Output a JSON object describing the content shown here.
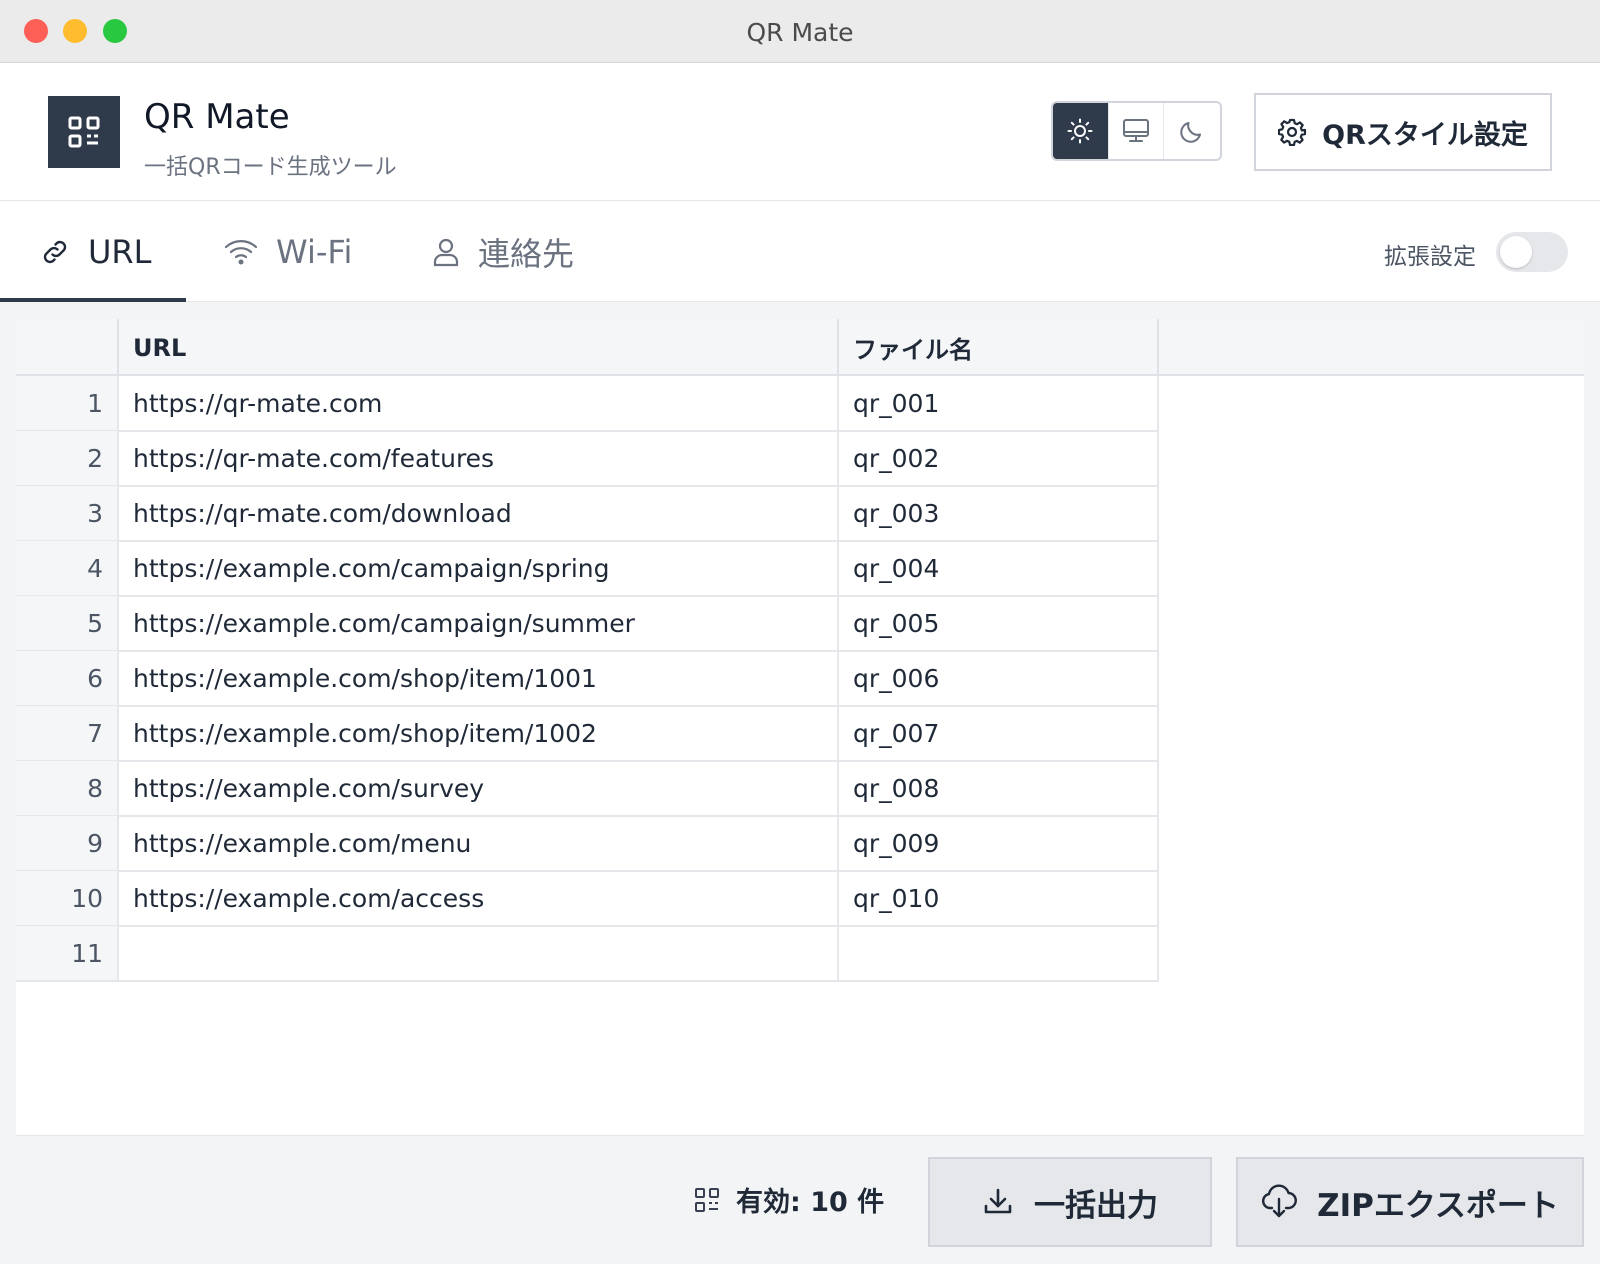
{
  "window": {
    "title": "QR Mate"
  },
  "header": {
    "app_name": "QR Mate",
    "subtitle": "一括QRコード生成ツール",
    "theme_options": [
      "sun-icon",
      "monitor-icon",
      "moon-icon"
    ],
    "active_theme": "light",
    "style_button_label": "QRスタイル設定"
  },
  "tabs": {
    "items": [
      {
        "label": "URL",
        "icon": "link-icon",
        "active": true
      },
      {
        "label": "Wi-Fi",
        "icon": "wifi-icon",
        "active": false
      },
      {
        "label": "連絡先",
        "icon": "user-icon",
        "active": false
      }
    ],
    "extended_settings_label": "拡張設定",
    "extended_settings_on": false
  },
  "table": {
    "columns": [
      "",
      "URL",
      "ファイル名"
    ],
    "rows": [
      {
        "num": "1",
        "url": "https://qr-mate.com",
        "file": "qr_001"
      },
      {
        "num": "2",
        "url": "https://qr-mate.com/features",
        "file": "qr_002"
      },
      {
        "num": "3",
        "url": "https://qr-mate.com/download",
        "file": "qr_003"
      },
      {
        "num": "4",
        "url": "https://example.com/campaign/spring",
        "file": "qr_004"
      },
      {
        "num": "5",
        "url": "https://example.com/campaign/summer",
        "file": "qr_005"
      },
      {
        "num": "6",
        "url": "https://example.com/shop/item/1001",
        "file": "qr_006"
      },
      {
        "num": "7",
        "url": "https://example.com/shop/item/1002",
        "file": "qr_007"
      },
      {
        "num": "8",
        "url": "https://example.com/survey",
        "file": "qr_008"
      },
      {
        "num": "9",
        "url": "https://example.com/menu",
        "file": "qr_009"
      },
      {
        "num": "10",
        "url": "https://example.com/access",
        "file": "qr_010"
      },
      {
        "num": "11",
        "url": "",
        "file": ""
      }
    ]
  },
  "footer": {
    "valid_count_label": "有効: 10 件",
    "export_label": "一括出力",
    "zip_label": "ZIPエクスポート"
  },
  "colors": {
    "accent": "#2f3a4b",
    "close": "#fe5f57",
    "minimize": "#febc2e",
    "maximize": "#28c840"
  }
}
